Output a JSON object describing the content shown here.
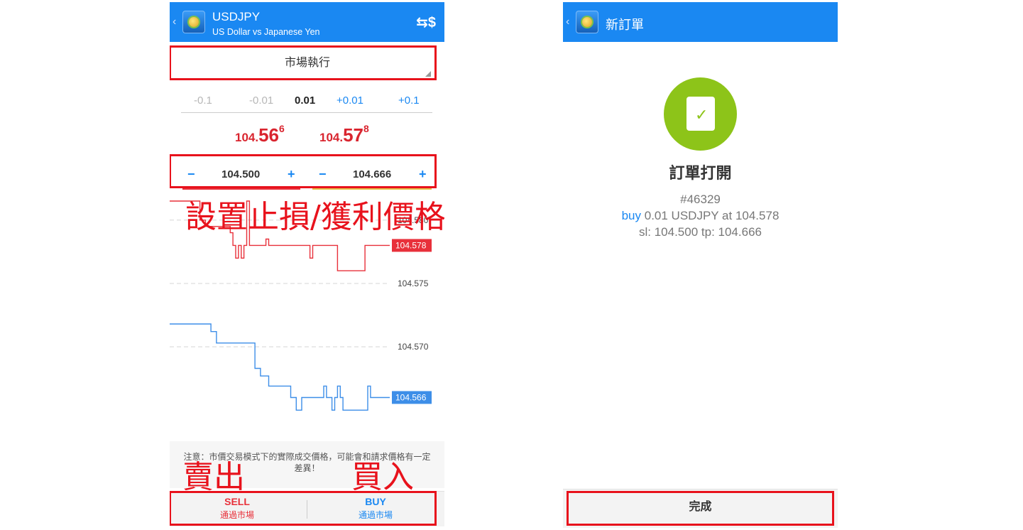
{
  "left": {
    "header": {
      "symbol": "USDJPY",
      "description": "US Dollar vs Japanese Yen",
      "back_glyph": "‹",
      "action_icon": "currency-exchange-icon",
      "action_glyph": "⇆$"
    },
    "execution_mode": "市場執行",
    "volume": {
      "minus_big": "-0.1",
      "minus_small": "-0.01",
      "current": "0.01",
      "plus_small": "+0.01",
      "plus_big": "+0.1"
    },
    "bid": {
      "prefix": "104.",
      "big": "56",
      "sup": "6"
    },
    "ask": {
      "prefix": "104.",
      "big": "57",
      "sup": "8"
    },
    "stop_loss": {
      "minus": "−",
      "value": "104.500",
      "plus": "+"
    },
    "take_profit": {
      "minus": "−",
      "value": "104.666",
      "plus": "+"
    },
    "annotation_sltp": "設置止損/獲利價格",
    "chart_data": {
      "type": "line",
      "y_ticks": [
        "104.580",
        "104.575",
        "104.570"
      ],
      "ask_tag": "104.578",
      "bid_tag": "104.566",
      "ylim": [
        104.563,
        104.5815
      ],
      "series": [
        {
          "color": "#e8303a",
          "values": [
            104.5815,
            104.5815,
            104.5815,
            104.5815,
            104.5815,
            104.5815,
            104.5815,
            104.5815,
            104.5815,
            104.5815,
            104.5815,
            104.58,
            104.58,
            104.5795,
            104.5795,
            104.5795,
            104.5795,
            104.5795,
            104.5795,
            104.5795,
            104.5795,
            104.5795,
            104.579,
            104.578,
            104.577,
            104.578,
            104.577,
            104.578,
            104.5815,
            104.578,
            104.578,
            104.578,
            104.578,
            104.578,
            104.578,
            104.5785,
            104.578,
            104.578,
            104.578,
            104.578,
            104.578,
            104.578,
            104.578,
            104.578,
            104.578,
            104.578,
            104.578,
            104.578,
            104.578,
            104.578,
            104.578,
            104.577,
            104.578,
            104.578,
            104.578,
            104.578,
            104.578,
            104.578,
            104.578,
            104.578,
            104.578,
            104.576,
            104.576,
            104.576,
            104.576,
            104.576,
            104.576,
            104.576,
            104.576,
            104.576,
            104.576,
            104.578,
            104.578,
            104.578,
            104.578,
            104.578,
            104.578,
            104.578,
            104.578,
            104.578,
            104.578
          ]
        },
        {
          "color": "#3d8ee8",
          "values": [
            104.5718,
            104.5718,
            104.5718,
            104.5718,
            104.5718,
            104.5718,
            104.5718,
            104.5718,
            104.5718,
            104.5718,
            104.5718,
            104.5718,
            104.5718,
            104.5718,
            104.5718,
            104.5712,
            104.5712,
            104.5703,
            104.5703,
            104.5703,
            104.5703,
            104.5703,
            104.5703,
            104.5703,
            104.5703,
            104.5703,
            104.5703,
            104.5703,
            104.5703,
            104.5703,
            104.5703,
            104.5683,
            104.5683,
            104.5677,
            104.5677,
            104.5677,
            104.5669,
            104.5669,
            104.5669,
            104.5669,
            104.5669,
            104.5669,
            104.5669,
            104.5669,
            104.566,
            104.566,
            104.565,
            104.565,
            104.566,
            104.566,
            104.566,
            104.566,
            104.566,
            104.566,
            104.566,
            104.566,
            104.5669,
            104.566,
            104.566,
            104.565,
            104.566,
            104.5669,
            104.566,
            104.565,
            104.565,
            104.565,
            104.565,
            104.565,
            104.565,
            104.565,
            104.565,
            104.565,
            104.5669,
            104.566,
            104.566,
            104.566,
            104.566,
            104.566,
            104.566,
            104.566,
            104.566
          ]
        }
      ]
    },
    "notice": "注意：市價交易模式下的實際成交價格，可能會和請求價格有一定差異！",
    "annotation_sell": "賣出",
    "annotation_buy": "買入",
    "sell": {
      "title": "SELL",
      "sub": "通過市場"
    },
    "buy": {
      "title": "BUY",
      "sub": "通過市場"
    }
  },
  "right": {
    "header": {
      "title": "新訂單",
      "back_glyph": "‹"
    },
    "success_icon": "order-document-check-icon",
    "success_title": "訂單打開",
    "order_number": "#46329",
    "order_side": "buy",
    "order_detail": "0.01 USDJPY at 104.578",
    "order_sltp": "sl: 104.500 tp: 104.666",
    "done_label": "完成"
  },
  "colors": {
    "brand_blue": "#1a88f2",
    "sell_red": "#e8303a",
    "annotation_red": "#e8121c",
    "success_green": "#8dc419"
  }
}
